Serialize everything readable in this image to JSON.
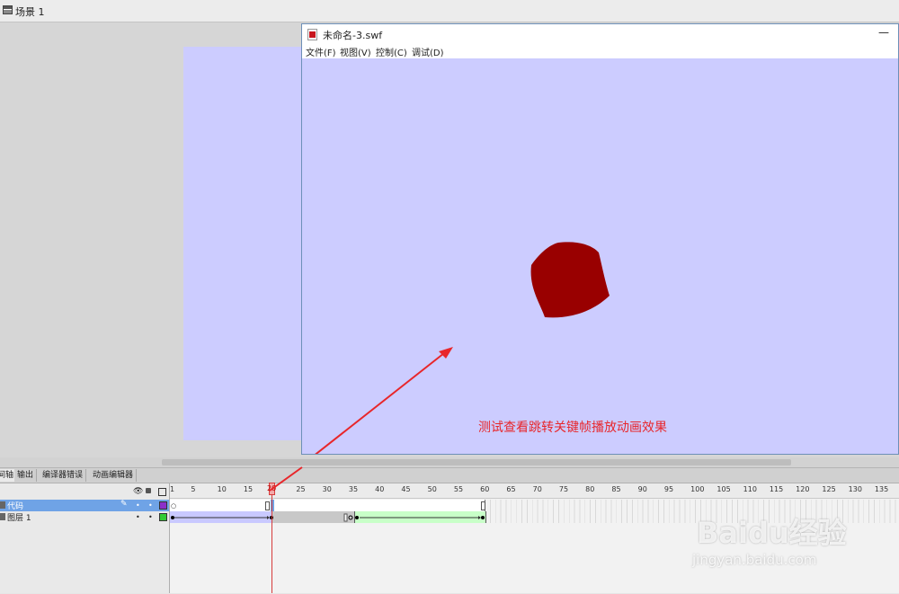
{
  "scene": {
    "label": "场景 1"
  },
  "swf_window": {
    "title": "未命名-3.swf",
    "minimize_glyph": "—",
    "menu": [
      "文件(F)",
      "视图(V)",
      "控制(C)",
      "调试(D)"
    ],
    "stage_color": "#ccccff",
    "shape_color": "#990000",
    "annotation": "测试查看跳转关键帧播放动画效果",
    "annotation_color": "#e8262a"
  },
  "timeline": {
    "tabs": [
      "时间轴",
      "输出",
      "编译器错误",
      "动画编辑器"
    ],
    "layers": [
      {
        "name": "代码",
        "selected": true,
        "color": "#8b2fc9"
      },
      {
        "name": "图层 1",
        "selected": false,
        "color": "#33cc33"
      }
    ],
    "ruler": [
      "1",
      "5",
      "10",
      "15",
      "20",
      "25",
      "30",
      "35",
      "40",
      "45",
      "50",
      "55",
      "60",
      "65",
      "70",
      "75",
      "80",
      "85",
      "90",
      "95",
      "100",
      "105",
      "110",
      "115",
      "120",
      "125",
      "130",
      "135"
    ],
    "current_frame": "20"
  },
  "watermark": {
    "brand": "Baidu经验",
    "url": "jingyan.baidu.com"
  }
}
